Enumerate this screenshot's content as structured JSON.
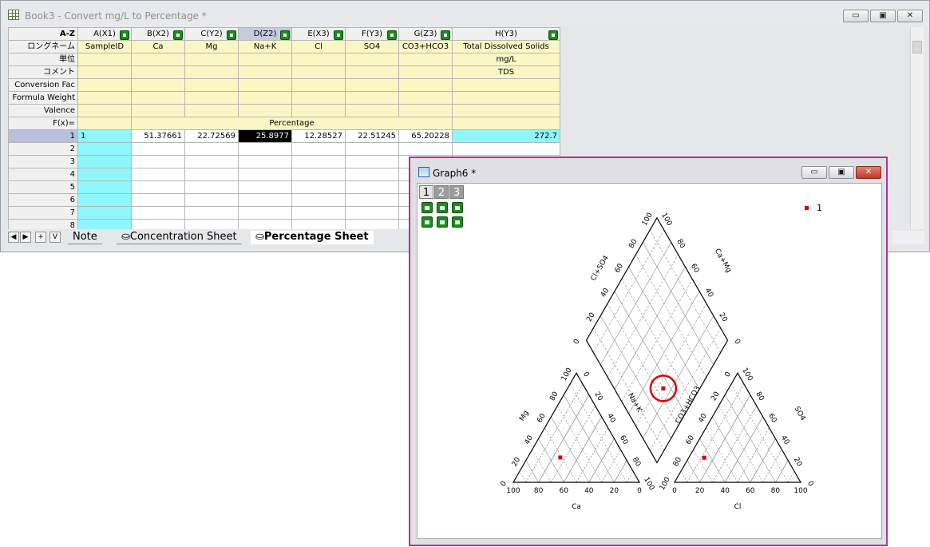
{
  "book": {
    "title": "Book3 - Convert mg/L to Percentage *",
    "controls": {
      "minimize": "▭",
      "restore": "▣",
      "close": "✕"
    },
    "corner_label": "A-Z",
    "columns": [
      {
        "name": "A(X1)",
        "longname": "SampleID",
        "unit": "",
        "comment": "",
        "selected": false
      },
      {
        "name": "B(X2)",
        "longname": "Ca",
        "unit": "",
        "comment": "",
        "selected": false
      },
      {
        "name": "C(Y2)",
        "longname": "Mg",
        "unit": "",
        "comment": "",
        "selected": false
      },
      {
        "name": "D(Z2)",
        "longname": "Na+K",
        "unit": "",
        "comment": "",
        "selected": true
      },
      {
        "name": "E(X3)",
        "longname": "Cl",
        "unit": "",
        "comment": "",
        "selected": false
      },
      {
        "name": "F(Y3)",
        "longname": "SO4",
        "unit": "",
        "comment": "",
        "selected": false
      },
      {
        "name": "G(Z3)",
        "longname": "CO3+HCO3",
        "unit": "",
        "comment": "",
        "selected": false
      },
      {
        "name": "H(Y3)",
        "longname": "Total Dissolved Solids",
        "unit": "mg/L",
        "comment": "TDS",
        "selected": false
      }
    ],
    "row_labels": {
      "longname": "ロングネーム",
      "unit": "単位",
      "comment": "コメント",
      "conversion": "Conversion Fac",
      "formula_weight": "Formula Weight",
      "valence": "Valence",
      "fx": "F(x)="
    },
    "fx_value": "Percentage",
    "rows": [
      {
        "index": "1",
        "cells": [
          "1",
          "51.37661",
          "22.72569",
          "25.8977",
          "12.28527",
          "22.51245",
          "65.20228",
          "272.7"
        ]
      },
      {
        "index": "2",
        "cells": [
          "",
          "",
          "",
          "",
          "",
          "",
          "",
          ""
        ]
      },
      {
        "index": "3",
        "cells": [
          "",
          "",
          "",
          "",
          "",
          "",
          "",
          ""
        ]
      },
      {
        "index": "4",
        "cells": [
          "",
          "",
          "",
          "",
          "",
          "",
          "",
          ""
        ]
      },
      {
        "index": "5",
        "cells": [
          "",
          "",
          "",
          "",
          "",
          "",
          "",
          ""
        ]
      },
      {
        "index": "6",
        "cells": [
          "",
          "",
          "",
          "",
          "",
          "",
          "",
          ""
        ]
      },
      {
        "index": "7",
        "cells": [
          "",
          "",
          "",
          "",
          "",
          "",
          "",
          ""
        ]
      },
      {
        "index": "8",
        "cells": [
          "",
          "",
          "",
          "",
          "",
          "",
          "",
          ""
        ]
      }
    ],
    "tabs": {
      "nav": [
        "◀",
        "▶",
        "+",
        "V"
      ],
      "items": [
        "Note",
        "Concentration Sheet",
        "Percentage Sheet"
      ],
      "active_index": 2
    }
  },
  "graph": {
    "title": "Graph6 *",
    "controls": {
      "minimize": "▭",
      "restore": "▣",
      "close": "✕"
    },
    "layer_tabs": [
      "1",
      "2",
      "3"
    ],
    "active_layer": "1",
    "legend": {
      "label": "1",
      "color": "#e00000"
    },
    "chart_data": {
      "type": "piper",
      "cation_triangle": {
        "axes": {
          "bottom": "Ca",
          "left": "Mg",
          "right": "Na+K"
        },
        "ticks": [
          "0",
          "20",
          "40",
          "60",
          "80",
          "100"
        ],
        "point": {
          "Ca": 51.37661,
          "Mg": 22.72569,
          "Na+K": 25.8977
        }
      },
      "anion_triangle": {
        "axes": {
          "bottom": "Cl",
          "left": "CO3+HCO3",
          "right": "SO4"
        },
        "ticks": [
          "0",
          "20",
          "40",
          "60",
          "80",
          "100"
        ],
        "point": {
          "Cl": 12.28527,
          "SO4": 22.51245,
          "CO3+HCO3": 65.20228
        }
      },
      "diamond": {
        "axes": {
          "upper_left": "Cl+SO4",
          "upper_right": "Ca+Mg"
        },
        "ticks": [
          "0",
          "20",
          "40",
          "60",
          "80",
          "100"
        ],
        "highlight_circle_color": "#e00000"
      },
      "series": [
        {
          "name": "1",
          "color": "#e00000"
        }
      ]
    }
  }
}
